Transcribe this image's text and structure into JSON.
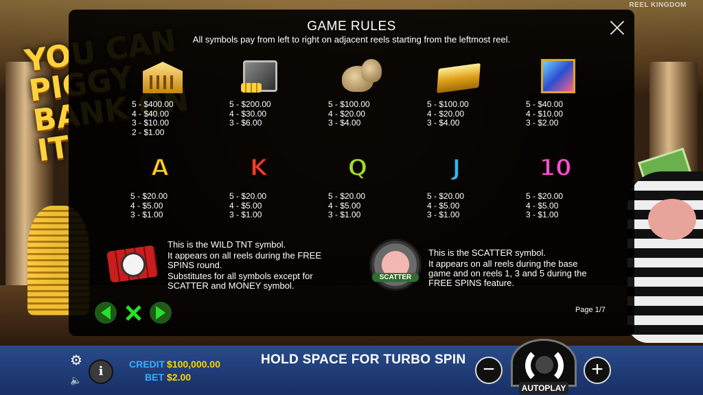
{
  "brand": {
    "watermark": "REEL KINGDOM",
    "logo_text": "YOU CAN PIGGY BANK ON IT"
  },
  "rules": {
    "title": "GAME RULES",
    "subtitle": "All symbols pay from left to right on adjacent reels starting from the leftmost reel.",
    "page": "Page 1/7",
    "high_symbols": [
      {
        "icon": "bank-icon",
        "pays": [
          "5 - $400.00",
          "4 - $40.00",
          "3 - $10.00",
          "2 - $1.00"
        ]
      },
      {
        "icon": "safe-icon",
        "pays": [
          "5 - $200.00",
          "4 - $30.00",
          "3 - $6.00"
        ]
      },
      {
        "icon": "money-bags-icon",
        "pays": [
          "5 - $100.00",
          "4 - $20.00",
          "3 - $4.00"
        ]
      },
      {
        "icon": "gold-bars-icon",
        "pays": [
          "5 - $100.00",
          "4 - $20.00",
          "3 - $4.00"
        ]
      },
      {
        "icon": "gems-icon",
        "pays": [
          "5 - $40.00",
          "4 - $10.00",
          "3 - $2.00"
        ]
      }
    ],
    "low_symbols": [
      {
        "letter": "A",
        "color": "#ffd21e",
        "pays": [
          "5 - $20.00",
          "4 - $5.00",
          "3 - $1.00"
        ]
      },
      {
        "letter": "K",
        "color": "#ff3b2a",
        "pays": [
          "5 - $20.00",
          "4 - $5.00",
          "3 - $1.00"
        ]
      },
      {
        "letter": "Q",
        "color": "#9be02a",
        "pays": [
          "5 - $20.00",
          "4 - $5.00",
          "3 - $1.00"
        ]
      },
      {
        "letter": "J",
        "color": "#2ab8ff",
        "pays": [
          "5 - $20.00",
          "4 - $5.00",
          "3 - $1.00"
        ]
      },
      {
        "letter": "10",
        "color": "#ff4fd8",
        "pays": [
          "5 - $20.00",
          "4 - $5.00",
          "3 - $1.00"
        ]
      }
    ],
    "wild": {
      "icon": "tnt-icon",
      "lines": [
        "This is the WILD TNT symbol.",
        "It appears on all reels during the FREE SPINS round.",
        "Substitutes for all symbols except for SCATTER and MONEY symbol."
      ]
    },
    "scatter": {
      "icon": "scatter-icon",
      "badge": "SCATTER",
      "lines": [
        "This is the SCATTER symbol.",
        "It appears on all reels during the base game and on reels 1, 3 and 5 during the FREE SPINS feature."
      ]
    }
  },
  "bottom_bar": {
    "credit_label": "CREDIT",
    "credit_value": "$100,000.00",
    "bet_label": "BET",
    "bet_value": "$2.00",
    "turbo_hint": "HOLD SPACE FOR TURBO SPIN",
    "minus": "−",
    "plus": "+",
    "info": "i",
    "autoplay": "AUTOPLAY"
  }
}
